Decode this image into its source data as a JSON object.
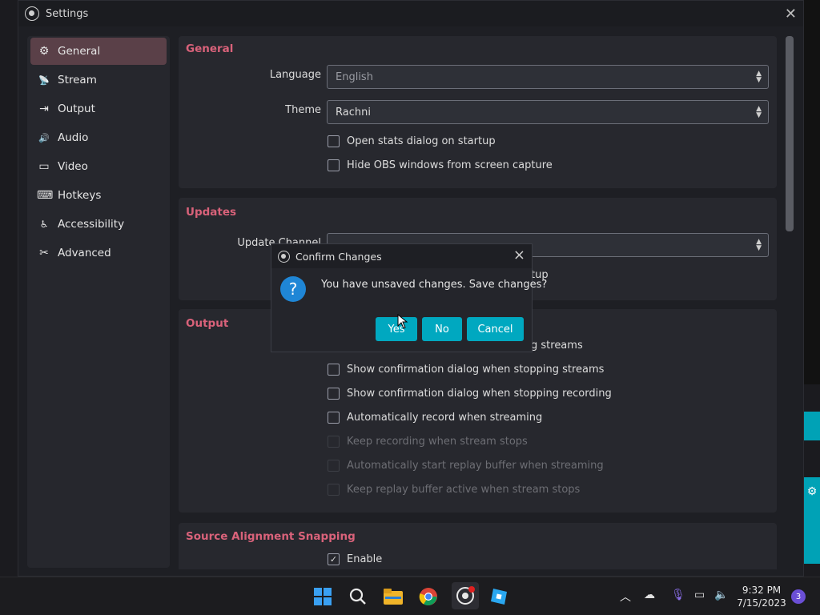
{
  "window": {
    "title": "Settings",
    "close_symbol": "✕"
  },
  "sidebar": {
    "items": [
      {
        "label": "General",
        "icon": "gear-icon",
        "glyph": "⚙"
      },
      {
        "label": "Stream",
        "icon": "broadcast-icon",
        "glyph": "📡"
      },
      {
        "label": "Output",
        "icon": "output-icon",
        "glyph": "⇥"
      },
      {
        "label": "Audio",
        "icon": "speaker-icon",
        "glyph": "🔊"
      },
      {
        "label": "Video",
        "icon": "monitor-icon",
        "glyph": "▭"
      },
      {
        "label": "Hotkeys",
        "icon": "keyboard-icon",
        "glyph": "⌨"
      },
      {
        "label": "Accessibility",
        "icon": "accessibility-icon",
        "glyph": "♿"
      },
      {
        "label": "Advanced",
        "icon": "wrench-icon",
        "glyph": "✂"
      }
    ],
    "active": "General"
  },
  "general": {
    "title": "General",
    "language_label": "Language",
    "language_value": "English",
    "theme_label": "Theme",
    "theme_value": "Rachni",
    "checks": [
      "Open stats dialog on startup",
      "Hide OBS windows from screen capture"
    ]
  },
  "updates": {
    "title": "Updates",
    "channel_label": "Update Channel",
    "startup_partial": "tup"
  },
  "output": {
    "title": "Output",
    "partial_first": "g streams",
    "checks": [
      {
        "label": "Show confirmation dialog when stopping streams",
        "checked": false,
        "enabled": true
      },
      {
        "label": "Show confirmation dialog when stopping recording",
        "checked": false,
        "enabled": true
      },
      {
        "label": "Automatically record when streaming",
        "checked": false,
        "enabled": true
      },
      {
        "label": "Keep recording when stream stops",
        "checked": false,
        "enabled": false
      },
      {
        "label": "Automatically start replay buffer when streaming",
        "checked": false,
        "enabled": false
      },
      {
        "label": "Keep replay buffer active when stream stops",
        "checked": false,
        "enabled": false
      }
    ]
  },
  "snapping": {
    "title": "Source Alignment Snapping",
    "enable_label": "Enable",
    "enable_checked": true
  },
  "dialog": {
    "title": "Confirm Changes",
    "message": "You have unsaved changes. Save changes?",
    "yes": "Yes",
    "no": "No",
    "cancel": "Cancel",
    "icon": "question-icon",
    "icon_glyph": "?"
  },
  "taskbar": {
    "time": "9:32 PM",
    "date": "7/15/2023",
    "tray_icons": [
      "chevron-up-icon",
      "cloud-off-icon",
      "microphone-icon",
      "display-icon",
      "volume-icon"
    ]
  },
  "colors": {
    "accent": "#00a8c0",
    "section_title": "#d9627a",
    "active_item": "#5a4048"
  }
}
